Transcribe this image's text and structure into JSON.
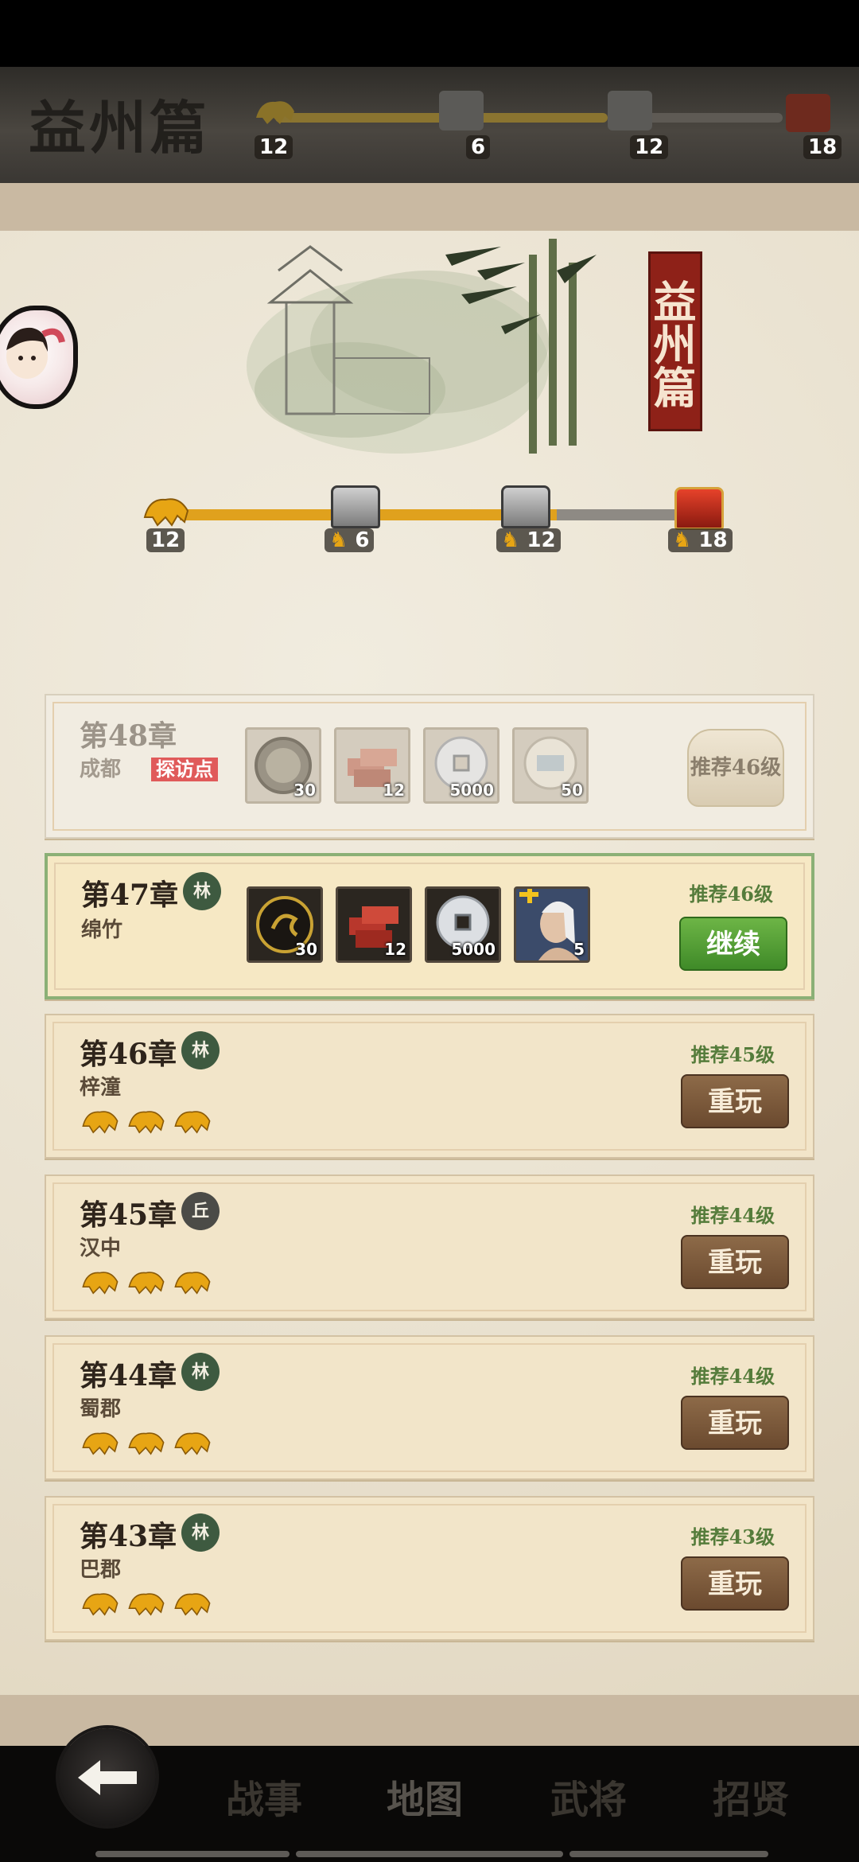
{
  "top_banner": {
    "title": "益州篇",
    "milestones": [
      "12",
      "6",
      "12",
      "18"
    ]
  },
  "painting": {
    "vertical_title": "益州篇"
  },
  "progress": {
    "start_label": "12",
    "milestones": [
      {
        "label": "6",
        "type": "silver-chest"
      },
      {
        "label": "12",
        "type": "silver-chest"
      },
      {
        "label": "18",
        "type": "red-chest"
      }
    ],
    "filled_fraction": 0.67
  },
  "chapters": [
    {
      "title": "第48章",
      "location": "成都",
      "tag": "探访点",
      "locked_label": "推荐46级",
      "rewards": [
        {
          "icon": "coin-emblem-icon",
          "qty": "30"
        },
        {
          "icon": "bricks-icon",
          "qty": "12"
        },
        {
          "icon": "copper-coin-icon",
          "qty": "5000"
        },
        {
          "icon": "scroll-coin-icon",
          "qty": "50"
        }
      ]
    },
    {
      "title": "第47章",
      "terrain": "林",
      "location": "绵竹",
      "rec_level": "推荐46级",
      "button": "继续",
      "rewards": [
        {
          "icon": "coin-emblem-icon",
          "qty": "30"
        },
        {
          "icon": "bricks-icon",
          "qty": "12"
        },
        {
          "icon": "copper-coin-icon",
          "qty": "5000"
        },
        {
          "icon": "general-portrait-icon",
          "qty": "5"
        }
      ]
    },
    {
      "title": "第46章",
      "terrain": "林",
      "location": "梓潼",
      "rec_level": "推荐45级",
      "button": "重玩",
      "stars": 3
    },
    {
      "title": "第45章",
      "terrain": "丘",
      "location": "汉中",
      "rec_level": "推荐44级",
      "button": "重玩",
      "stars": 3
    },
    {
      "title": "第44章",
      "terrain": "林",
      "location": "蜀郡",
      "rec_level": "推荐44级",
      "button": "重玩",
      "stars": 3
    },
    {
      "title": "第43章",
      "terrain": "林",
      "location": "巴郡",
      "rec_level": "推荐43级",
      "button": "重玩",
      "stars": 3
    }
  ],
  "nav": {
    "tabs": [
      "战事",
      "地图",
      "武将",
      "招贤"
    ],
    "active": "地图"
  },
  "colors": {
    "progress_gold": "#e0a11d",
    "progress_gray": "#8e8a84",
    "continue_green": "#4f9d31",
    "replay_brown": "#7a5837",
    "seal_red": "#8e2118"
  }
}
